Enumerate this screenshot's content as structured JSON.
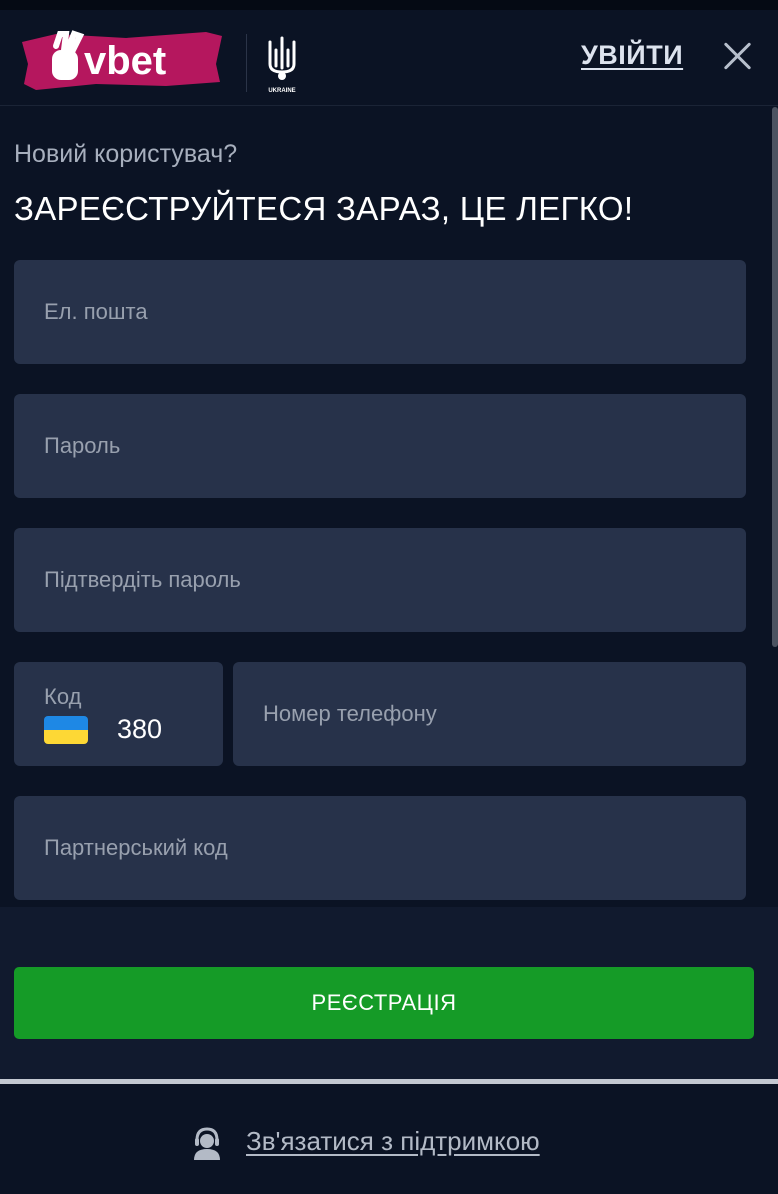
{
  "header": {
    "login_label": "УВІЙТИ"
  },
  "icons": {
    "logo": "vbet-logo",
    "emblem": "ukraine-trident-emblem",
    "close": "close-icon",
    "support": "support-agent-icon",
    "flag": "ukraine-flag-icon"
  },
  "form": {
    "subtitle": "Новий користувач?",
    "headline": "ЗАРЕЄСТРУЙТЕСЯ ЗАРАЗ, ЦЕ ЛЕГКО!",
    "email_placeholder": "Ел. пошта",
    "password_placeholder": "Пароль",
    "confirm_placeholder": "Підтвердіть пароль",
    "code_label": "Код",
    "code_value": "380",
    "phone_placeholder": "Номер телефону",
    "partner_placeholder": "Партнерський код",
    "submit_label": "РЕЄСТРАЦІЯ"
  },
  "footer": {
    "support_label": "Зв'язатися з підтримкою"
  },
  "colors": {
    "background": "#0b1324",
    "field": "#27324a",
    "accent_green": "#159b27",
    "logo_pink": "#c2185b"
  }
}
